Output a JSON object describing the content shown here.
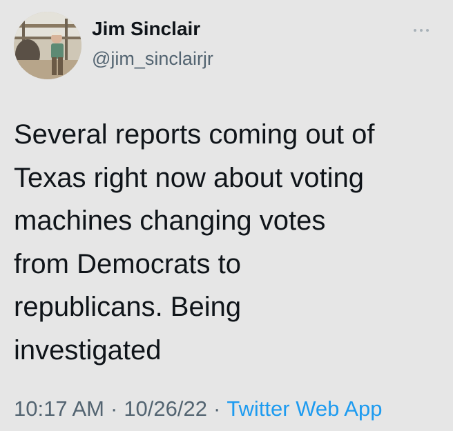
{
  "tweet": {
    "author": {
      "display_name": "Jim Sinclair",
      "handle": "@jim_sinclairjr"
    },
    "more_icon": "more-horizontal-icon",
    "text": "Several reports coming out of\nTexas right now about voting\nmachines changing votes\nfrom Democrats to\nrepublicans.  Being\ninvestigated",
    "time": "10:17 AM",
    "separator": "·",
    "date": "10/26/22",
    "source": "Twitter Web App"
  },
  "colors": {
    "background": "#e6e6e6",
    "text": "#0f1419",
    "secondary_text": "#536471",
    "link": "#1d9bf0"
  }
}
